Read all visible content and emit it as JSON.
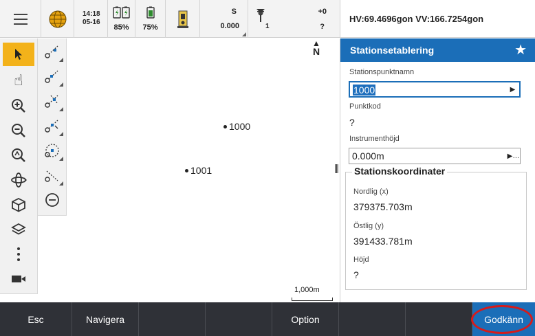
{
  "status": {
    "time": "14:18",
    "date": "05-16",
    "battery1_pct": "85%",
    "battery2_pct": "75%",
    "measure_mode": "S",
    "measure_value": "0.000",
    "prism_number": "1",
    "prism_offset": "+0",
    "prism_height": "?",
    "icons": [
      "menu-icon",
      "globe-icon",
      "battery-icon",
      "instrument-icon",
      "prism-icon"
    ]
  },
  "angles": "HV:69.4696gon  VV:166.7254gon",
  "map": {
    "north": "N",
    "points": [
      {
        "label": "1000"
      },
      {
        "label": "1001"
      }
    ],
    "scale": "1,000m",
    "tools": [
      "select-arrow-icon",
      "pan-hand-icon",
      "zoom-in-icon",
      "zoom-out-icon",
      "zoom-extents-icon",
      "orbit-icon",
      "cube-view-icon",
      "layers-icon",
      "more-icon",
      "video-icon"
    ],
    "snap_tools": [
      "snap-end-icon",
      "snap-mid-icon",
      "snap-intersect-icon",
      "snap-perp-icon",
      "snap-center-icon",
      "snap-line-icon",
      "snap-off-icon"
    ]
  },
  "panel": {
    "title": "Stationsetablering",
    "station_name_label": "Stationspunktnamn",
    "station_name_value": "1000",
    "code_label": "Punktkod",
    "code_value": "?",
    "height_label": "Instrumenthöjd",
    "height_value": "0.000m",
    "coords_title": "Stationskoordinater",
    "north_label": "Nordlig (x)",
    "north_value": "379375.703m",
    "east_label": "Östlig (y)",
    "east_value": "391433.781m",
    "elev_label": "Höjd",
    "elev_value": "?"
  },
  "softkeys": {
    "esc": "Esc",
    "navigate": "Navigera",
    "option": "Option",
    "accept": "Godkänn"
  },
  "colors": {
    "accent": "#1b6eb8",
    "bottom_bar": "#2f3137",
    "active_tool": "#f3b21a",
    "highlight_ring": "#d61b1b"
  }
}
